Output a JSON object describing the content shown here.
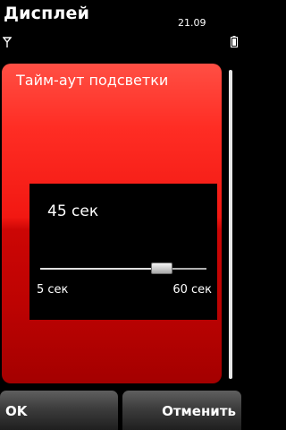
{
  "status_bar": {
    "title": "Дисплей",
    "clock": "21.09",
    "signal_icon": "antenna-signal-icon",
    "battery_icon": "battery-icon"
  },
  "content": {
    "item_label": "Тайм-аут подсветки"
  },
  "slider_popup": {
    "value_text": "45 сек",
    "min_label": "5 сек",
    "max_label": "60 сек",
    "fraction": 0.73
  },
  "softkeys": {
    "left": "OK",
    "right": "Отменить"
  },
  "colors": {
    "accent_red": "#e8150f",
    "background": "#000000"
  }
}
